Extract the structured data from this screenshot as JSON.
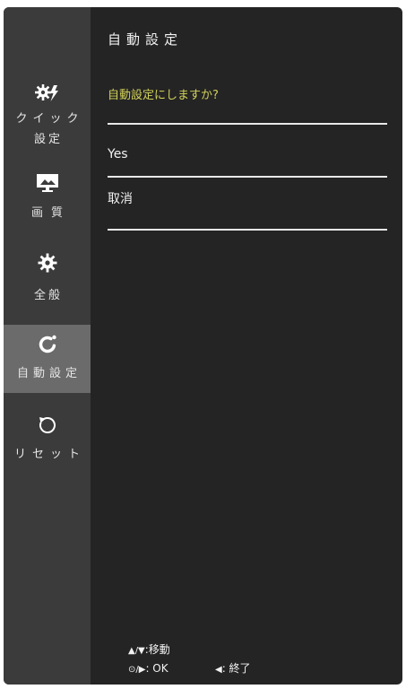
{
  "sidebar": {
    "selected_index": 3,
    "items": [
      {
        "icon": "quick-settings-icon",
        "label_lines": [
          "クイック",
          "設定"
        ]
      },
      {
        "icon": "picture-icon",
        "label": "画質"
      },
      {
        "icon": "gear-icon",
        "label": "全般"
      },
      {
        "icon": "auto-adjust-icon",
        "label": "自動設定"
      },
      {
        "icon": "reset-icon",
        "label": "リセット"
      }
    ]
  },
  "main": {
    "title": "自動設定",
    "question": "自動設定にしますか?",
    "options": [
      {
        "label": "Yes"
      },
      {
        "label": "取消"
      }
    ]
  },
  "footer": {
    "navigate": {
      "keys": "▲/▼",
      "action": ":移動"
    },
    "confirm": {
      "keys": "⊙/▶",
      "action": ": OK"
    },
    "exit": {
      "keys": "◀",
      "action": ": 終了"
    }
  },
  "colors": {
    "sidebar_bg": "#3b3b3b",
    "selected_bg": "#6b6b6b",
    "main_bg": "#242424",
    "question_text": "#d2d25a",
    "text": "#f2f2f2"
  }
}
